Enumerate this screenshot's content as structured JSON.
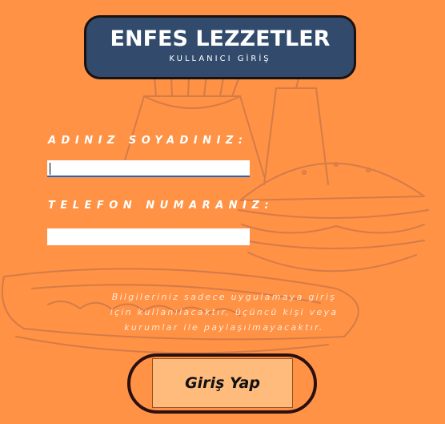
{
  "header": {
    "title": "ENFES LEZZETLER",
    "subtitle": "KULLANICI GİRİŞ"
  },
  "form": {
    "name_label": "ADINIZ SOYADINIZ:",
    "name_value": "",
    "phone_label": "TELEFON NUMARANIZ:",
    "phone_value": ""
  },
  "disclaimer": {
    "line1": "Bilgileriniz sadece uygulamaya giriş",
    "line2": "için kullanılacaktır, üçüncü kişi veya",
    "line3": "kurumlar ile paylaşılmayacaktır."
  },
  "login_button_label": "Giriş Yap",
  "colors": {
    "background": "#ff9245",
    "header": "#324a6b",
    "button": "#ffbb7c",
    "art_line": "#c8744a"
  },
  "icons": {
    "background_art": "fries-burger-hotdog-illustration"
  }
}
